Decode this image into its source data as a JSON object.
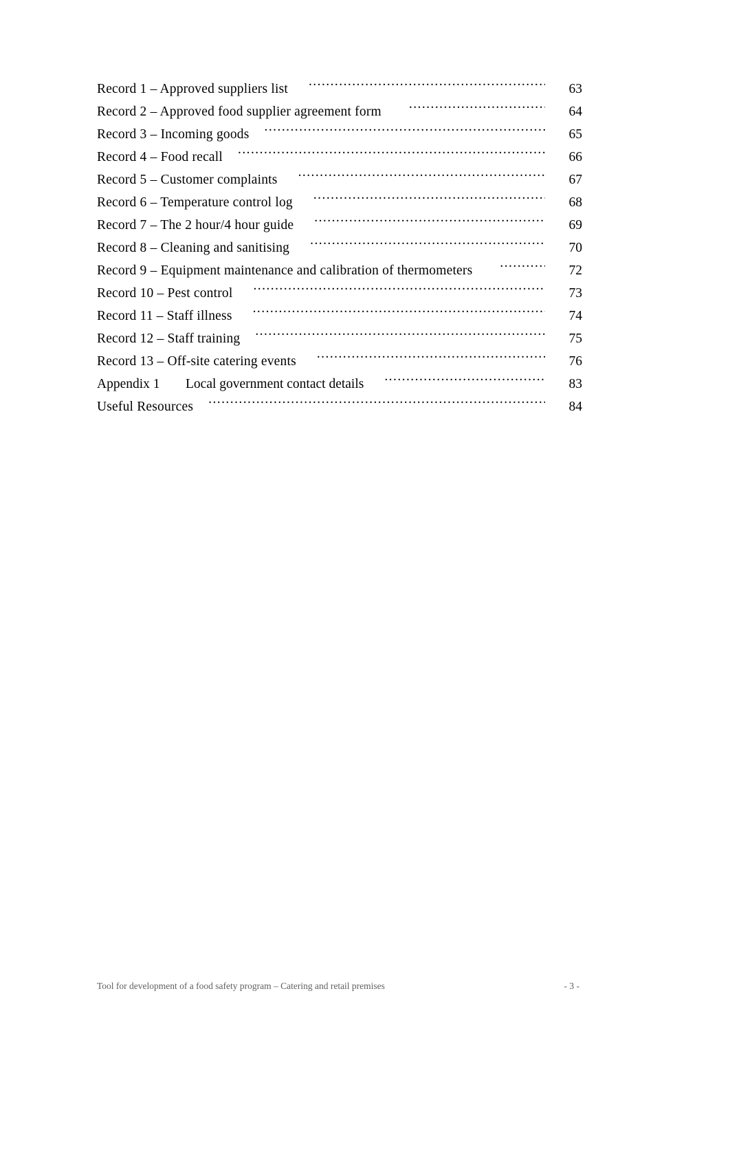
{
  "document": {
    "type": "table-of-contents-page",
    "page_label": "- 3 -",
    "footer_text": "Tool for development of a food safety program – Catering and retail premises"
  },
  "toc": {
    "entries": [
      {
        "label": "Record 1 – Approved suppliers list",
        "page": "63"
      },
      {
        "label": "Record 2 – Approved food supplier agreement form",
        "page": "64"
      },
      {
        "label": "Record 3 – Incoming goods",
        "page": "65"
      },
      {
        "label": "Record 4 – Food recall",
        "page": "66"
      },
      {
        "label": "Record 5 – Customer complaints",
        "page": "67"
      },
      {
        "label": "Record 6 – Temperature control log",
        "page": "68"
      },
      {
        "label": "Record 7 – The 2 hour/4 hour guide",
        "page": "69"
      },
      {
        "label": "Record 8 – Cleaning and sanitising",
        "page": "70"
      },
      {
        "label": "Record 9 – Equipment maintenance and calibration of thermometers",
        "page": "72"
      },
      {
        "label": "Record 10 – Pest control",
        "page": "73"
      },
      {
        "label": "Record 11 – Staff illness",
        "page": "74"
      },
      {
        "label": "Record 12 – Staff training",
        "page": "75"
      },
      {
        "label": "Record 13 – Off-site catering events",
        "page": "76"
      },
      {
        "label": "Appendix 1",
        "title": "Local government contact details",
        "page": "83"
      },
      {
        "label": "Useful Resources",
        "page": "84"
      }
    ]
  }
}
